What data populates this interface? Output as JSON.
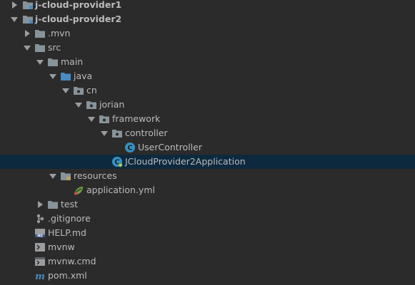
{
  "tree": {
    "items": [
      {
        "label": "j-cloud-provider1",
        "icon": "module-folder-icon"
      },
      {
        "label": "j-cloud-provider2",
        "icon": "module-folder-icon"
      },
      {
        "label": ".mvn",
        "icon": "folder-icon"
      },
      {
        "label": "src",
        "icon": "folder-icon"
      },
      {
        "label": "main",
        "icon": "folder-icon"
      },
      {
        "label": "java",
        "icon": "source-folder-icon"
      },
      {
        "label": "cn",
        "icon": "package-icon"
      },
      {
        "label": "jorian",
        "icon": "package-icon"
      },
      {
        "label": "framework",
        "icon": "package-icon"
      },
      {
        "label": "controller",
        "icon": "package-icon"
      },
      {
        "label": "UserController",
        "icon": "java-class-icon"
      },
      {
        "label": "JCloudProvider2Application",
        "icon": "spring-boot-class-icon"
      },
      {
        "label": "resources",
        "icon": "resources-folder-icon"
      },
      {
        "label": "application.yml",
        "icon": "spring-config-icon"
      },
      {
        "label": "test",
        "icon": "folder-icon"
      },
      {
        "label": ".gitignore",
        "icon": "gitignore-icon"
      },
      {
        "label": "HELP.md",
        "icon": "markdown-icon"
      },
      {
        "label": "mvnw",
        "icon": "shell-script-icon"
      },
      {
        "label": "mvnw.cmd",
        "icon": "cmd-file-icon"
      },
      {
        "label": "pom.xml",
        "icon": "maven-pom-icon"
      }
    ]
  },
  "colors": {
    "background": "#2b2b2b",
    "selection": "#0d293e",
    "text": "#bbbbbb",
    "folder": "#87939a",
    "source_folder": "#4a8bc2",
    "class": "#3592c4",
    "spring": "#6a8759"
  }
}
